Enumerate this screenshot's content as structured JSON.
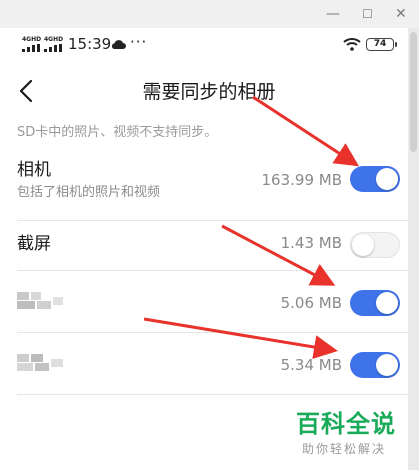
{
  "status_bar": {
    "signal_1": "4GHD",
    "signal_2": "4GHD",
    "time": "15:39",
    "more": "···",
    "battery": "74"
  },
  "header": {
    "title": "需要同步的相册"
  },
  "note": "SD卡中的照片、视频不支持同步。",
  "albums": [
    {
      "name": "相机",
      "subtitle": "包括了相机的照片和视频",
      "size": "163.99 MB",
      "sync_enabled": true
    },
    {
      "name": "截屏",
      "size": "1.43 MB",
      "sync_enabled": false
    },
    {
      "name": "",
      "size": "5.06 MB",
      "sync_enabled": true
    },
    {
      "name": "",
      "size": "5.34 MB",
      "sync_enabled": true
    }
  ],
  "watermark": {
    "title": "百科全说",
    "subtitle": "助你轻松解决"
  },
  "colors": {
    "toggle_on": "#3f73ea",
    "annotation_arrow": "#e8322b",
    "watermark": "#1aab5a"
  }
}
